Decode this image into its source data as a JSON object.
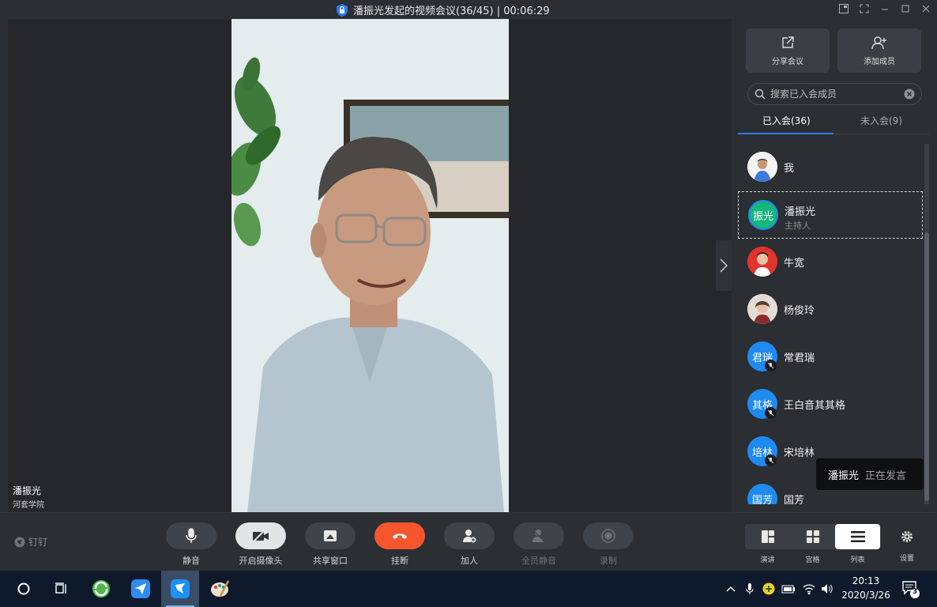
{
  "window": {
    "title": "潘振光发起的视频会议(36/45) | 00:06:29"
  },
  "video": {
    "speaker_name": "潘振光",
    "speaker_org": "河套学院"
  },
  "panel": {
    "share_label": "分享会议",
    "add_member_label": "添加成员",
    "search_placeholder": "搜索已入会成员",
    "tabs": {
      "joined": "已入会(36)",
      "not_joined": "未入会(9)"
    },
    "members": [
      {
        "name": "我",
        "role": "",
        "avatar_text": "",
        "muted": false
      },
      {
        "name": "潘振光",
        "role": "主持人",
        "avatar_text": "振光",
        "muted": false
      },
      {
        "name": "牛宽",
        "role": "",
        "avatar_text": "",
        "muted": false
      },
      {
        "name": "杨俊玲",
        "role": "",
        "avatar_text": "",
        "muted": false
      },
      {
        "name": "常君瑞",
        "role": "",
        "avatar_text": "君瑞",
        "muted": true
      },
      {
        "name": "王白音其其格",
        "role": "",
        "avatar_text": "其格",
        "muted": true
      },
      {
        "name": "宋培林",
        "role": "",
        "avatar_text": "培林",
        "muted": true
      },
      {
        "name": "国芳",
        "role": "",
        "avatar_text": "国芳",
        "muted": false
      }
    ],
    "toast": {
      "who": "潘振光",
      "what": "正在发言"
    }
  },
  "toolbar": {
    "brand": "钉钉",
    "buttons": {
      "mute": "静音",
      "camera": "开启摄像头",
      "share": "共享窗口",
      "hangup": "挂断",
      "add": "加人",
      "mute_all": "全员静音",
      "record": "录制"
    },
    "views": {
      "presenter": "演讲",
      "grid": "宫格",
      "list": "列表"
    },
    "settings": "设置"
  },
  "taskbar": {
    "time": "20:13",
    "date": "2020/3/26",
    "notification_count": "3"
  },
  "colors": {
    "accent": "#2f7bf0",
    "hangup": "#f5562e",
    "avatar_blue": "#1f8af0"
  }
}
